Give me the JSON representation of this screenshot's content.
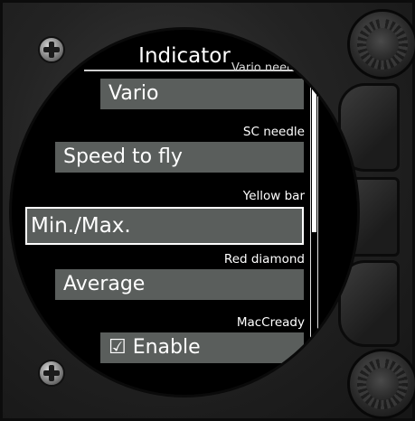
{
  "screen": {
    "title": "Indicator",
    "partial_label": "Vario needle",
    "rows": [
      {
        "label": "",
        "value": "Vario"
      },
      {
        "label": "SC needle",
        "value": "Speed to fly"
      },
      {
        "label": "Yellow bar",
        "value": "Min./Max."
      },
      {
        "label": "Red diamond",
        "value": "Average"
      },
      {
        "label": "MacCready",
        "value": "☑ Enable"
      }
    ]
  },
  "colors": {
    "field_bg": "#5a5e5c",
    "screen_bg": "#000000",
    "text": "#ffffff"
  }
}
